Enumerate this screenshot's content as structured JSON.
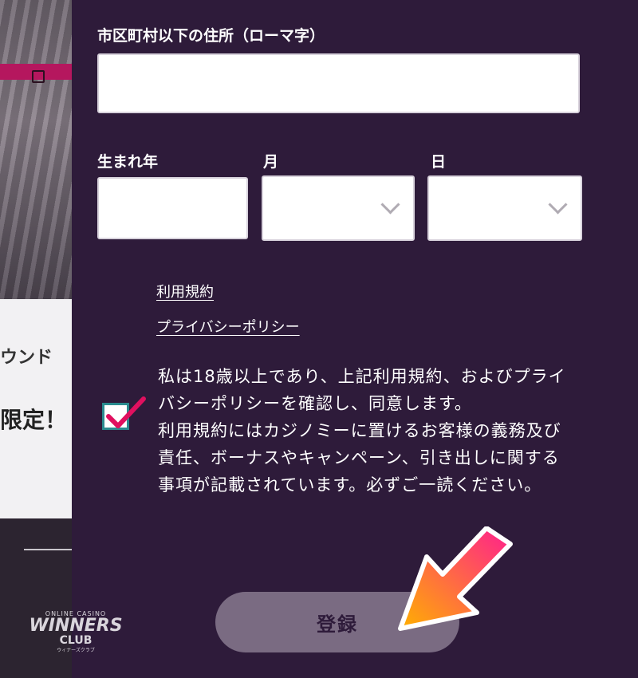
{
  "background": {
    "text_line1": "ウンド",
    "text_line2": "限定！"
  },
  "form": {
    "address_label": "市区町村以下の住所（ローマ字）",
    "address_value": "",
    "birth_year_label": "生まれ年",
    "birth_year_value": "",
    "month_label": "月",
    "month_value": "",
    "day_label": "日",
    "day_value": ""
  },
  "links": {
    "terms": "利用規約",
    "privacy": "プライバシーポリシー"
  },
  "consent": {
    "checked": true,
    "line1": "私は18歳以上であり、上記利用規約、およびプライバシーポリシーを確認し、同意します。",
    "line2": "利用規約にはカジノミーに置けるお客様の義務及び責任、ボーナスやキャンペーン、引き出しに関する事項が記載されています。必ずご一読ください。"
  },
  "register_button": {
    "label": "登録"
  },
  "logo": {
    "top_text": "ONLINE CASINO",
    "main_text": "WINNERS",
    "sub_text": "CLUB",
    "small_text": "ウィナーズクラブ"
  },
  "colors": {
    "panel_bg": "#2e1b3a",
    "button_bg": "#7a6b82",
    "checkbox_border": "#2a8b8f",
    "checkmark": "#e0105f",
    "arrow_start": "#ff1f8e",
    "arrow_end": "#ffb000"
  }
}
